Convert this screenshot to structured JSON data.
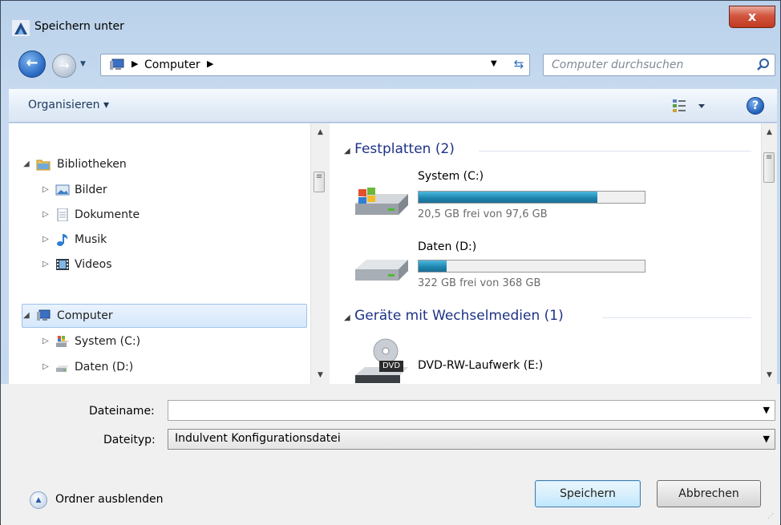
{
  "window": {
    "title": "Speichern unter",
    "close_label": "x"
  },
  "address": {
    "crumb": "Computer",
    "search_placeholder": "Computer durchsuchen"
  },
  "toolbar": {
    "organize": "Organisieren ▾",
    "help": "?"
  },
  "tree": {
    "libraries": "Bibliotheken",
    "items": [
      "Bilder",
      "Dokumente",
      "Musik",
      "Videos"
    ],
    "computer": "Computer",
    "drives": [
      "System (C:)",
      "Daten (D:)"
    ]
  },
  "content": {
    "group_hdd": "Festplatten (2)",
    "group_removable": "Geräte mit Wechselmedien (1)",
    "drives": [
      {
        "name": "System (C:)",
        "free": "20,5 GB frei von 97,6 GB",
        "used_fraction": 0.79
      },
      {
        "name": "Daten (D:)",
        "free": "322 GB frei von 368 GB",
        "used_fraction": 0.125
      }
    ],
    "dvd": "DVD-RW-Laufwerk (E:)",
    "dvd_badge": "DVD"
  },
  "form": {
    "filename_label": "Dateiname:",
    "filename_value": "",
    "filetype_label": "Dateityp:",
    "filetype_value": "Indulvent Konfigurationsdatei"
  },
  "footer": {
    "hide_folders": "Ordner ausblenden",
    "save": "Speichern",
    "cancel": "Abbrechen"
  },
  "colors": {
    "accent": "#1e3287",
    "bar": "#1d83ad"
  }
}
